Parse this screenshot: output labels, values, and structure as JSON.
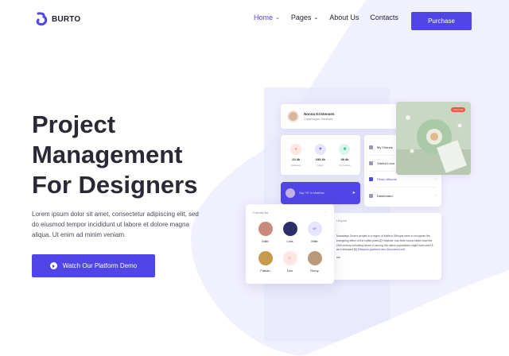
{
  "brand": {
    "name": "BURTO",
    "color": "#4f46e5"
  },
  "nav": {
    "items": [
      {
        "label": "Home",
        "has_caret": true,
        "active": true
      },
      {
        "label": "Pages",
        "has_caret": true,
        "active": false
      },
      {
        "label": "About Us",
        "has_caret": false,
        "active": false
      },
      {
        "label": "Contacts",
        "has_caret": false,
        "active": false
      }
    ],
    "purchase_label": "Purchase"
  },
  "hero": {
    "title_lines": [
      "Project",
      "Management",
      "For Designers"
    ],
    "description": "Lorem ipsum dolor sit amet, consectetur adipiscing elit, sed do eiusmod tempor incididunt ut labore et dolore magna aliqua. Ut enim ad minim veniam.",
    "cta_label": "Watch Our Platform Demo"
  },
  "dashboard": {
    "profile": {
      "name": "Nonna Kristensen",
      "location": "Copenhagen, Denmark"
    },
    "stats": [
      {
        "value": "22.4k",
        "label": "Followers",
        "icon": "user-icon",
        "color": "#f59a8a",
        "bg": "#fde7e2"
      },
      {
        "value": "193.4k",
        "label": "Likes",
        "icon": "heart-icon",
        "color": "#6c63ff",
        "bg": "#e6e4ff"
      },
      {
        "value": "49.4k",
        "label": "Comments",
        "icon": "chat-icon",
        "color": "#3fbf95",
        "bg": "#dcf5ec"
      }
    ],
    "menu": [
      {
        "label": "My Friends",
        "selected": false
      },
      {
        "label": "Visited Loca",
        "selected": false
      },
      {
        "label": "Photo Albums",
        "selected": true
      },
      {
        "label": "Dashboard",
        "selected": false
      }
    ],
    "say_hi": "Say \"Hi\" to Matthias",
    "photo_badge": "Live now",
    "post": {
      "head": "l expert",
      "text_before": "Nowadays Oromo people in a region of Kaffa in Ethiopia were to recognize the energizing effect of the coffee plant.[2] However, has been found earlier than the 15th century indicating where in among the native populations might have used it as a stimulant.[6] ",
      "text_link": "Ethiopian goatherd who discovered coff",
      "footer": "ore"
    },
    "friends": {
      "title": "Friends list",
      "items": [
        {
          "name": "Mille",
          "initials": "",
          "bg": "#c98a7b"
        },
        {
          "name": "Lora",
          "initials": "",
          "bg": "#2b2f6b"
        },
        {
          "name": "Mille",
          "initials": "MF",
          "bg": "#e6e4ff"
        },
        {
          "name": "Fabian",
          "initials": "",
          "bg": "#c79a4d"
        },
        {
          "name": "Luis",
          "initials": "LF",
          "bg": "#fde7e2"
        },
        {
          "name": "Romy",
          "initials": "",
          "bg": "#b99a7a"
        }
      ]
    }
  }
}
